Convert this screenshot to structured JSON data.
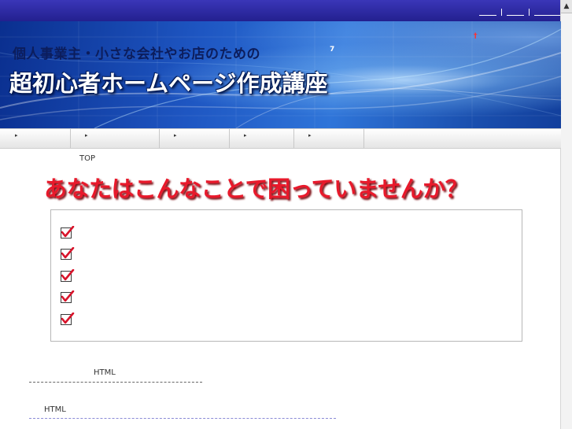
{
  "header": {
    "top_links_count": 3
  },
  "banner": {
    "subtitle": "個人事業主・小さな会社やお店のための",
    "title": "超初心者ホームページ作成講座",
    "small_mark": "7",
    "small_mark_2": "†"
  },
  "nav": {
    "items": [
      {
        "arrow": "▸"
      },
      {
        "arrow": "▸"
      },
      {
        "arrow": "▸"
      },
      {
        "arrow": "▸"
      },
      {
        "arrow": "▸"
      },
      {
        "arrow": ""
      }
    ]
  },
  "breadcrumb": {
    "current": "TOP"
  },
  "main": {
    "headline": "あなたはこんなことで困っていませんか？",
    "checklist_count": 5
  },
  "sections": [
    {
      "heading": "HTML"
    },
    {
      "heading": "HTML"
    }
  ],
  "colors": {
    "topbar": "#2a27a0",
    "headline": "#e8192b",
    "check": "#d8132a"
  }
}
